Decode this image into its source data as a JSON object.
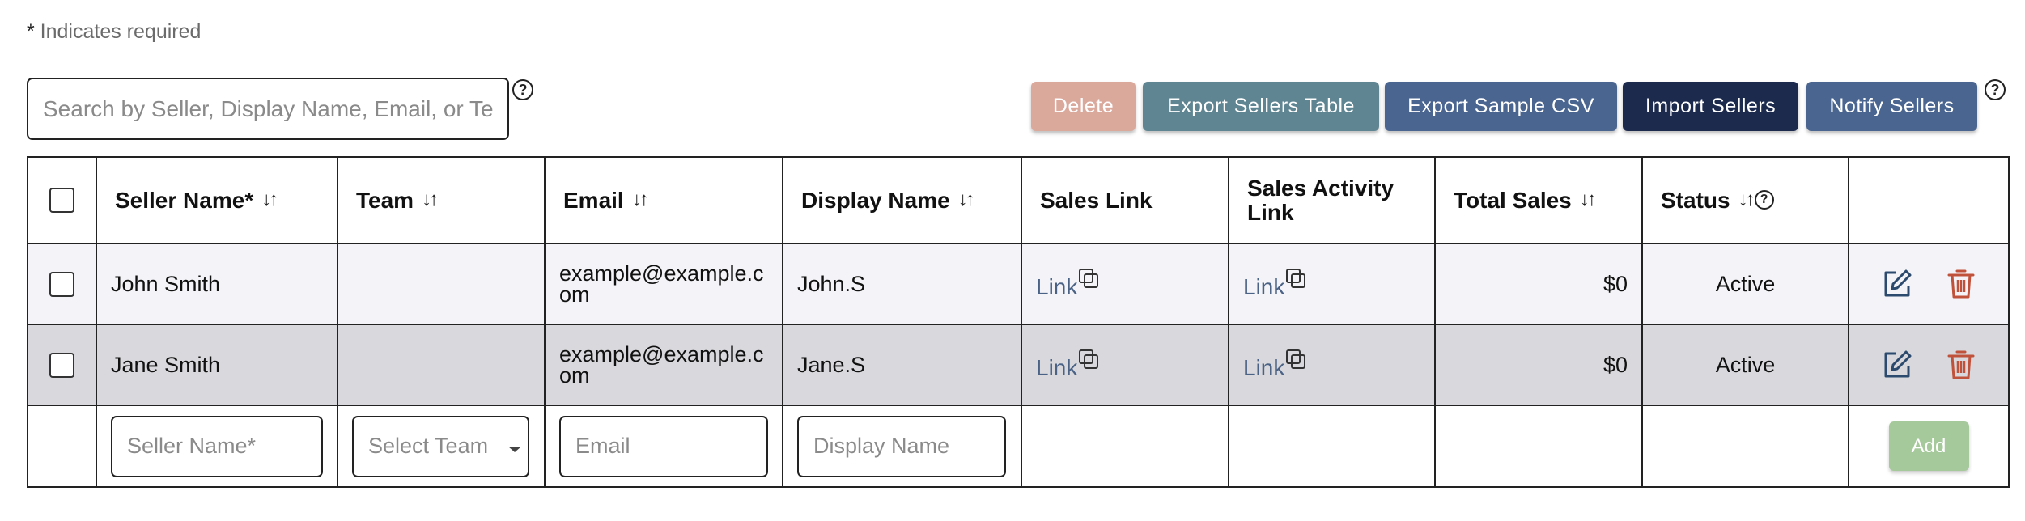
{
  "required_note": {
    "star": "*",
    "text": " Indicates required"
  },
  "search": {
    "placeholder": "Search by Seller, Display Name, Email, or Team"
  },
  "help_glyph": "?",
  "toolbar": {
    "delete_label": "Delete",
    "export_table_label": "Export Sellers Table",
    "export_csv_label": "Export Sample CSV",
    "import_label": "Import Sellers",
    "notify_label": "Notify Sellers"
  },
  "colors": {
    "delete_btn": "#dba89c",
    "export_table_btn": "#5f8592",
    "export_csv_btn": "#4a6590",
    "import_btn": "#1c2a4e",
    "notify_btn": "#4a6590",
    "add_btn": "#a6c99b",
    "link": "#4a6285",
    "active_status": "#3d8a2e",
    "edit_icon": "#2c4a6e",
    "delete_icon": "#c0513a"
  },
  "table": {
    "headers": {
      "seller_name": "Seller Name*",
      "team": "Team",
      "email": "Email",
      "display_name": "Display Name",
      "sales_link": "Sales Link",
      "sales_activity_link": "Sales Activity Link",
      "total_sales": "Total Sales",
      "status": "Status"
    },
    "sort_glyph": "↓↑",
    "rows": [
      {
        "seller_name": "John Smith",
        "team": "",
        "email": "example@example.com",
        "display_name": "John.S",
        "sales_link": "Link",
        "sales_activity_link": "Link",
        "total_sales": "$0",
        "status": "Active"
      },
      {
        "seller_name": "Jane Smith",
        "team": "",
        "email": "example@example.com",
        "display_name": "Jane.S",
        "sales_link": "Link",
        "sales_activity_link": "Link",
        "total_sales": "$0",
        "status": "Active"
      }
    ],
    "add_row": {
      "seller_name_placeholder": "Seller Name*",
      "team_placeholder": "Select Team",
      "email_placeholder": "Email",
      "display_name_placeholder": "Display Name",
      "add_label": "Add"
    }
  },
  "icons": {
    "help": "question-circle-icon",
    "sort": "sort-arrows-icon",
    "copy": "copy-icon",
    "edit": "edit-icon",
    "trash": "trash-icon",
    "caret": "chevron-down-icon"
  }
}
